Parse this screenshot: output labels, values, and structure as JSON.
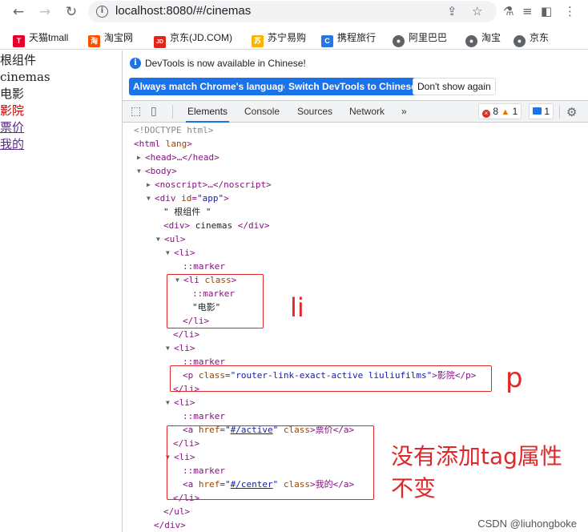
{
  "browser": {
    "url": "localhost:8080/#/cinemas",
    "nav": {
      "back": "←",
      "forward": "→",
      "reload": "↻"
    },
    "icons": [
      "share-icon",
      "star-icon",
      "flask-icon",
      "reading-list-icon",
      "sidebar-icon",
      "menu-icon"
    ]
  },
  "bookmarks": [
    {
      "label": "天猫tmall",
      "fav": "T",
      "color": "#e4002b"
    },
    {
      "label": "淘宝网",
      "fav": "淘",
      "color": "#ff5000"
    },
    {
      "label": "京东(JD.COM)",
      "fav": "JD",
      "color": "#e1251b"
    },
    {
      "label": "苏宁易购",
      "fav": "苏",
      "color": "#f9b300"
    },
    {
      "label": "携程旅行",
      "fav": "C",
      "color": "#2577e3"
    },
    {
      "label": "阿里巴巴",
      "fav": "●",
      "color": "#5f6368"
    },
    {
      "label": "淘宝",
      "fav": "●",
      "color": "#5f6368"
    },
    {
      "label": "京东",
      "fav": "●",
      "color": "#5f6368"
    }
  ],
  "page": {
    "root": "根组件",
    "cinemas": "cinemas",
    "film": "电影",
    "cinema_link": "影院",
    "price_link": "票价",
    "mine_link": "我的"
  },
  "devtools": {
    "info_message": "DevTools is now available in Chinese!",
    "btn_match": "Always match Chrome's language",
    "btn_switch": "Switch DevTools to Chinese",
    "btn_dismiss": "Don't show again",
    "tabs": [
      "Elements",
      "Console",
      "Sources",
      "Network"
    ],
    "more_tabs": "»",
    "error_count": "8",
    "warning_count": "1",
    "message_count": "1"
  },
  "dom": {
    "doctype": "<!DOCTYPE html>",
    "html_open": "<html",
    "html_attr": "lang",
    "head": "<head>…</head>",
    "body_open": "<body>",
    "noscript": "<noscript>…</noscript>",
    "div_open": "<div",
    "div_attr": "id",
    "div_val": "\"app\"",
    "text_root": "\" 根组件 \"",
    "div_cinemas_open": "<div>",
    "div_cinemas_text": " cinemas ",
    "div_cinemas_close": "</div>",
    "ul_open": "<ul>",
    "li_open": "<li>",
    "li_close": "</li>",
    "marker": "::marker",
    "li_class_open": "<li",
    "li_class_attr": "class",
    "li_class_close": ">",
    "film_text": "\"电影\"",
    "p_open": "<p",
    "p_attr": "class",
    "p_val": "\"router-link-exact-active liuliufilms\"",
    "p_text": ">影院</p>",
    "a_open": "<a",
    "a_attr": "href",
    "a_active_href": "#/active",
    "a_class": "class",
    "a_active_text": ">票价</a>",
    "a_center_href": "#/center",
    "a_center_text": ">我的</a>",
    "ul_close": "</ul>",
    "div_close": "</div>"
  },
  "annotations": {
    "li": "li",
    "p": "p",
    "note_line1": "没有添加tag属性",
    "note_line2": "不变",
    "watermark": "CSDN @liuhongboke"
  }
}
